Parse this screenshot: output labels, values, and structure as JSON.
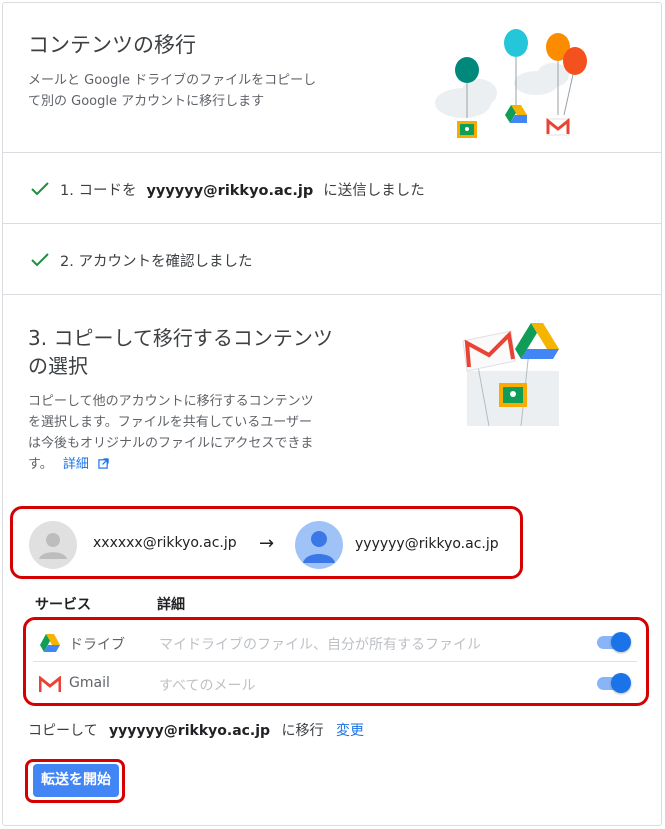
{
  "header": {
    "title": "コンテンツの移行",
    "description_line1": "メールと Google ドライブのファイルをコピーし",
    "description_line2": "て別の Google アカウントに移行します",
    "illustration_icon": "balloons-drive-gmail-classroom-illustration"
  },
  "steps": {
    "step1_prefix": "1. コードを",
    "step1_email": "yyyyyy@rikkyo.ac.jp",
    "step1_suffix": "に送信しました",
    "step2": "2. アカウントを確認しました"
  },
  "section3": {
    "title_line1": "3. コピーして移行するコンテンツ",
    "title_line2": "の選択",
    "desc_line1": "コピーして他のアカウントに移行するコンテンツ",
    "desc_line2": "を選択します。ファイルを共有しているユーザー",
    "desc_line3": "は今後もオリジナルのファイルにアクセスできま",
    "desc_line4": "す。",
    "details_link": "詳細",
    "illustration_icon": "box-gmail-drive-classroom-illustration"
  },
  "accounts": {
    "source_email": "xxxxxx@rikkyo.ac.jp",
    "arrow": "→",
    "target_email": "yyyyyy@rikkyo.ac.jp"
  },
  "table": {
    "col_service": "サービス",
    "col_details": "詳細",
    "rows": [
      {
        "icon": "google-drive-icon",
        "label": "ドライブ",
        "detail": "マイドライブのファイル、自分が所有するファイル",
        "enabled": true
      },
      {
        "icon": "gmail-icon",
        "label": "Gmail",
        "detail": "すべてのメール",
        "enabled": true
      }
    ]
  },
  "copy_to": {
    "prefix": "コピーして",
    "email": "yyyyyy@rikkyo.ac.jp",
    "suffix": "に移行",
    "change_link": "変更"
  },
  "start_button": "転送を開始",
  "colors": {
    "accent": "#1a73e8",
    "check": "#1e8e3e",
    "highlight_red": "#d50000",
    "button": "#4285f4"
  }
}
